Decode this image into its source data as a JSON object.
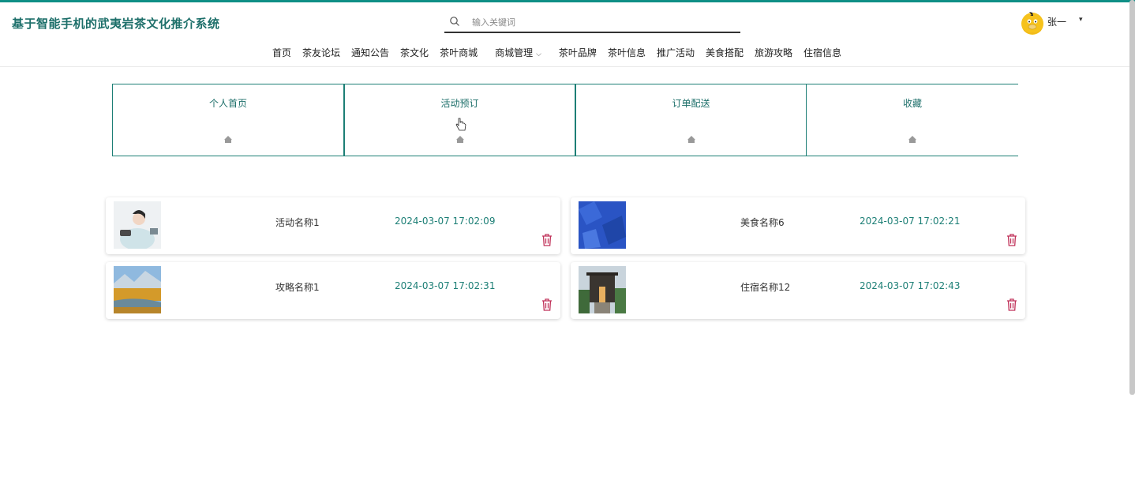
{
  "header": {
    "title": "基于智能手机的武夷岩茶文化推介系统",
    "search_placeholder": "输入关键词",
    "user_name": "张一",
    "user_caret": "▾"
  },
  "nav": {
    "items": [
      "首页",
      "茶友论坛",
      "通知公告",
      "茶文化",
      "茶叶商城"
    ],
    "dropdown_label": "商城管理",
    "dropdown_chevron": "⌵",
    "items_after": [
      "茶叶品牌",
      "茶叶信息",
      "推广活动",
      "美食搭配",
      "旅游攻略",
      "住宿信息"
    ]
  },
  "tabs": [
    "个人首页",
    "活动预订",
    "订单配送",
    "收藏"
  ],
  "favorites": [
    {
      "name": "活动名称1",
      "time": "2024-03-07 17:02:09"
    },
    {
      "name": "美食名称6",
      "time": "2024-03-07 17:02:21"
    },
    {
      "name": "攻略名称1",
      "time": "2024-03-07 17:02:31"
    },
    {
      "name": "住宿名称12",
      "time": "2024-03-07 17:02:43"
    }
  ],
  "colors": {
    "accent": "#1d7f76",
    "delete": "#c0335a",
    "top_line": "#0f8f86"
  },
  "icons": {
    "search": "search-icon",
    "delete": "trash-icon",
    "tab": "home-icon",
    "avatar": "duck-avatar"
  }
}
